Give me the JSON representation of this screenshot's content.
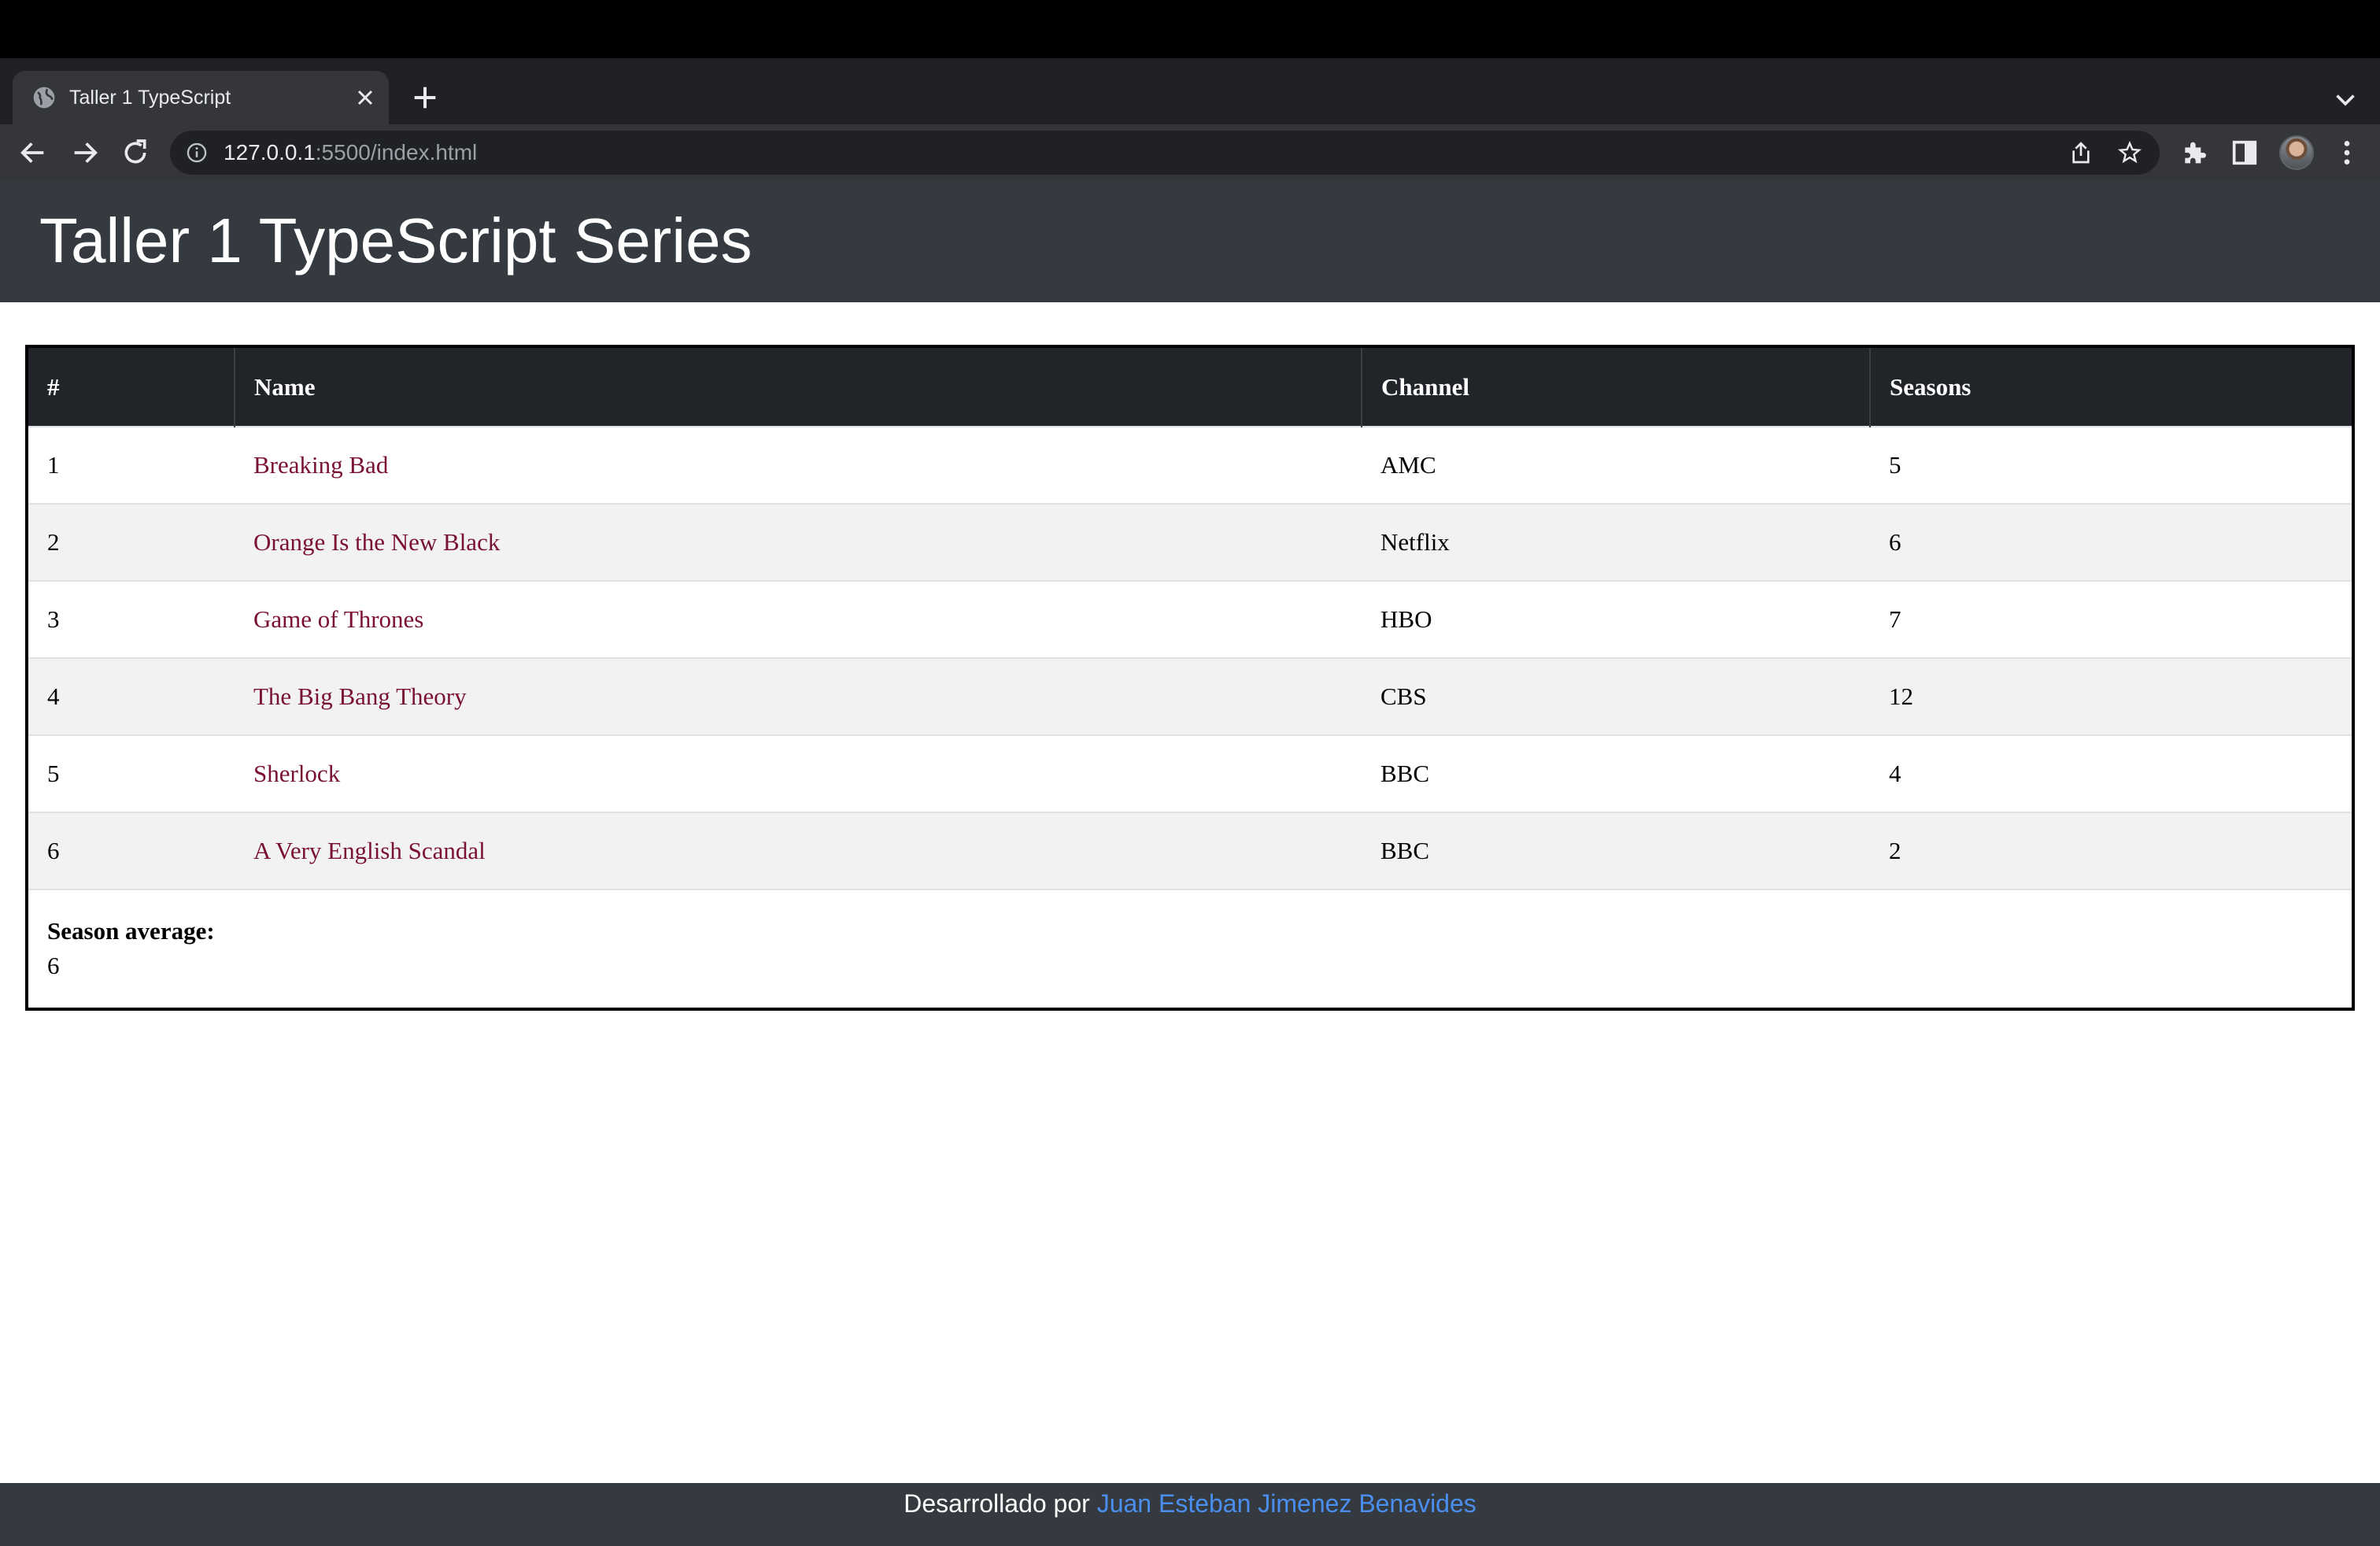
{
  "browser": {
    "tab_title": "Taller 1 TypeScript",
    "url_host": "127.0.0.1",
    "url_rest": ":5500/index.html"
  },
  "page": {
    "title": "Taller 1 TypeScript Series"
  },
  "table": {
    "headers": [
      "#",
      "Name",
      "Channel",
      "Seasons"
    ],
    "rows": [
      {
        "num": "1",
        "name": "Breaking Bad",
        "channel": "AMC",
        "seasons": "5"
      },
      {
        "num": "2",
        "name": "Orange Is the New Black",
        "channel": "Netflix",
        "seasons": "6"
      },
      {
        "num": "3",
        "name": "Game of Thrones",
        "channel": "HBO",
        "seasons": "7"
      },
      {
        "num": "4",
        "name": "The Big Bang Theory",
        "channel": "CBS",
        "seasons": "12"
      },
      {
        "num": "5",
        "name": "Sherlock",
        "channel": "BBC",
        "seasons": "4"
      },
      {
        "num": "6",
        "name": "A Very English Scandal",
        "channel": "BBC",
        "seasons": "2"
      }
    ],
    "average_label": "Season average:",
    "average_value": "6"
  },
  "footer": {
    "prefix": "Desarrollado por ",
    "author": "Juan Esteban Jimenez Benavides"
  },
  "colors": {
    "header_bg": "#343a40",
    "table_head_bg": "#212529",
    "link": "#7a1035",
    "footer_link": "#4a8ff0"
  }
}
